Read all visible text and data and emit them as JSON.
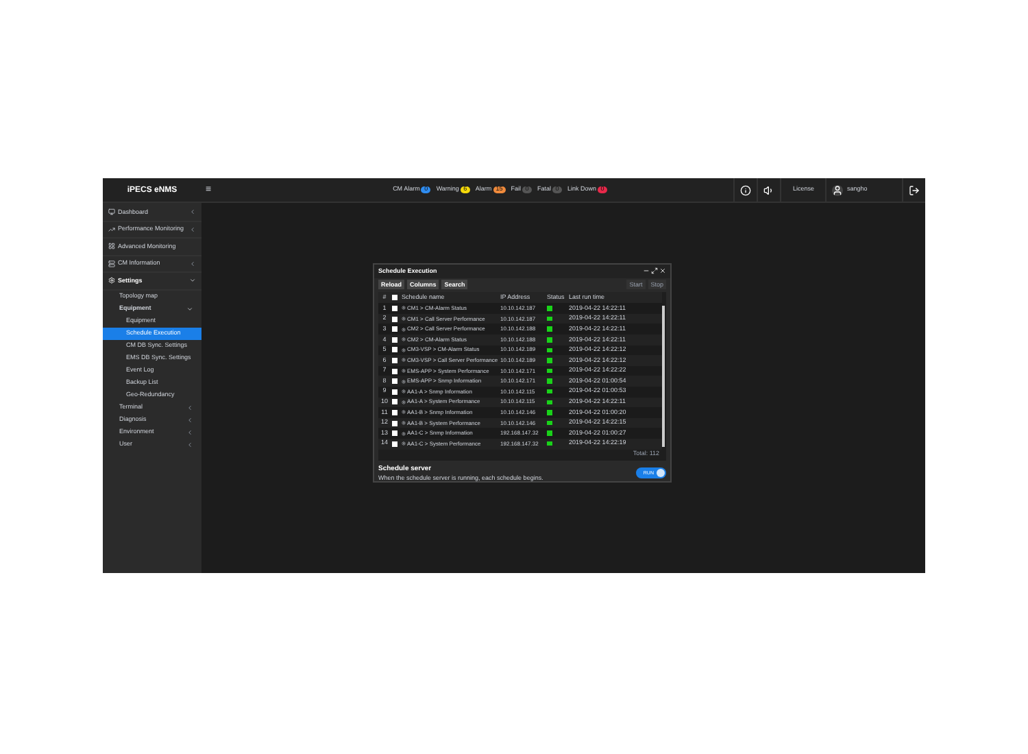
{
  "app": {
    "logo": "iPECS eNMS"
  },
  "topbar": {
    "menu_glyph": "≡",
    "counters": [
      {
        "label": "CM Alarm",
        "count": "0",
        "color": "#2f8cf0"
      },
      {
        "label": "Warning",
        "count": "6",
        "color": "#f5d90a"
      },
      {
        "label": "Alarm",
        "count": "15",
        "color": "#f08a3c"
      },
      {
        "label": "Fail",
        "count": "0",
        "color": "#555555"
      },
      {
        "label": "Fatal",
        "count": "0",
        "color": "#555555"
      },
      {
        "label": "Link Down",
        "count": "0",
        "color": "#e8294a"
      }
    ],
    "license": "License",
    "user": "sangho"
  },
  "sidebar": {
    "items": [
      {
        "label": "Dashboard",
        "expanded": false
      },
      {
        "label": "Performance Monitoring",
        "expanded": false
      },
      {
        "label": "Advanced Monitoring"
      },
      {
        "label": "CM Information",
        "expanded": false
      },
      {
        "label": "Settings",
        "expanded": true,
        "children": [
          {
            "label": "Topology map",
            "selected": false
          },
          {
            "label": "Equipment",
            "expanded": true,
            "selected": false,
            "children": [
              {
                "label": "Equipment",
                "selected": false
              },
              {
                "label": "Schedule Execution",
                "selected": true
              },
              {
                "label": "CM DB Sync. Settings",
                "selected": false
              },
              {
                "label": "EMS DB Sync. Settings",
                "selected": false
              },
              {
                "label": "Event Log",
                "selected": false
              },
              {
                "label": "Backup List",
                "selected": false
              },
              {
                "label": "Geo-Redundancy",
                "selected": false
              }
            ]
          },
          {
            "label": "Terminal",
            "expanded": false,
            "selected": false
          },
          {
            "label": "Diagnosis",
            "expanded": false,
            "selected": false
          },
          {
            "label": "Environment",
            "expanded": false,
            "selected": false
          },
          {
            "label": "User",
            "expanded": false,
            "selected": false
          }
        ]
      }
    ]
  },
  "dialog": {
    "title": "Schedule Execution",
    "toolbar": [
      {
        "label": "Reload",
        "disabled": false
      },
      {
        "label": "Columns",
        "disabled": false
      },
      {
        "label": "Search",
        "disabled": false
      }
    ],
    "actions": [
      {
        "label": "Start",
        "disabled": true
      },
      {
        "label": "Stop",
        "disabled": true
      }
    ],
    "table": {
      "header_checked": false,
      "columns": [
        "#",
        "Schedule name",
        "IP Address",
        "Status",
        "Last run time"
      ],
      "rows": [
        {
          "no": "1",
          "checked": false,
          "name": "CM1 > CM-Alarm Status",
          "ip": "10.10.142.187",
          "time": "2019-04-22 14:22:11"
        },
        {
          "no": "2",
          "checked": false,
          "name": "CM1 > Call Server Performance",
          "ip": "10.10.142.187",
          "time": "2019-04-22 14:22:11"
        },
        {
          "no": "3",
          "checked": false,
          "name": "CM2 > Call Server Performance",
          "ip": "10.10.142.188",
          "time": "2019-04-22 14:22:11"
        },
        {
          "no": "4",
          "checked": false,
          "name": "CM2 > CM-Alarm Status",
          "ip": "10.10.142.188",
          "time": "2019-04-22 14:22:11"
        },
        {
          "no": "5",
          "checked": false,
          "name": "CM3-VSP > CM-Alarm Status",
          "ip": "10.10.142.189",
          "time": "2019-04-22 14:22:12"
        },
        {
          "no": "6",
          "checked": false,
          "name": "CM3-VSP > Call Server Performance",
          "ip": "10.10.142.189",
          "time": "2019-04-22 14:22:12"
        },
        {
          "no": "7",
          "checked": false,
          "name": "EMS-APP > System Performance",
          "ip": "10.10.142.171",
          "time": "2019-04-22 14:22:22"
        },
        {
          "no": "8",
          "checked": false,
          "name": "EMS-APP > Snmp Information",
          "ip": "10.10.142.171",
          "time": "2019-04-22 01:00:54"
        },
        {
          "no": "9",
          "checked": false,
          "name": "AA1-A > Snmp Information",
          "ip": "10.10.142.115",
          "time": "2019-04-22 01:00:53"
        },
        {
          "no": "10",
          "checked": false,
          "name": "AA1-A > System Performance",
          "ip": "10.10.142.115",
          "time": "2019-04-22 14:22:11"
        },
        {
          "no": "11",
          "checked": false,
          "name": "AA1-B > Snmp Information",
          "ip": "10.10.142.146",
          "time": "2019-04-22 01:00:20"
        },
        {
          "no": "12",
          "checked": false,
          "name": "AA1-B > System Performance",
          "ip": "10.10.142.146",
          "time": "2019-04-22 14:22:15"
        },
        {
          "no": "13",
          "checked": false,
          "name": "AA1-C > Snmp Information",
          "ip": "192.168.147.32",
          "time": "2019-04-22 01:00:27"
        },
        {
          "no": "14",
          "checked": false,
          "name": "AA1-C > System Performance",
          "ip": "192.168.147.32",
          "time": "2019-04-22 14:22:19"
        }
      ],
      "total": "Total: 112"
    },
    "server": {
      "title": "Schedule server",
      "description": "When the schedule server is running, each schedule begins.",
      "toggle_label": "RUN",
      "on": true
    }
  }
}
